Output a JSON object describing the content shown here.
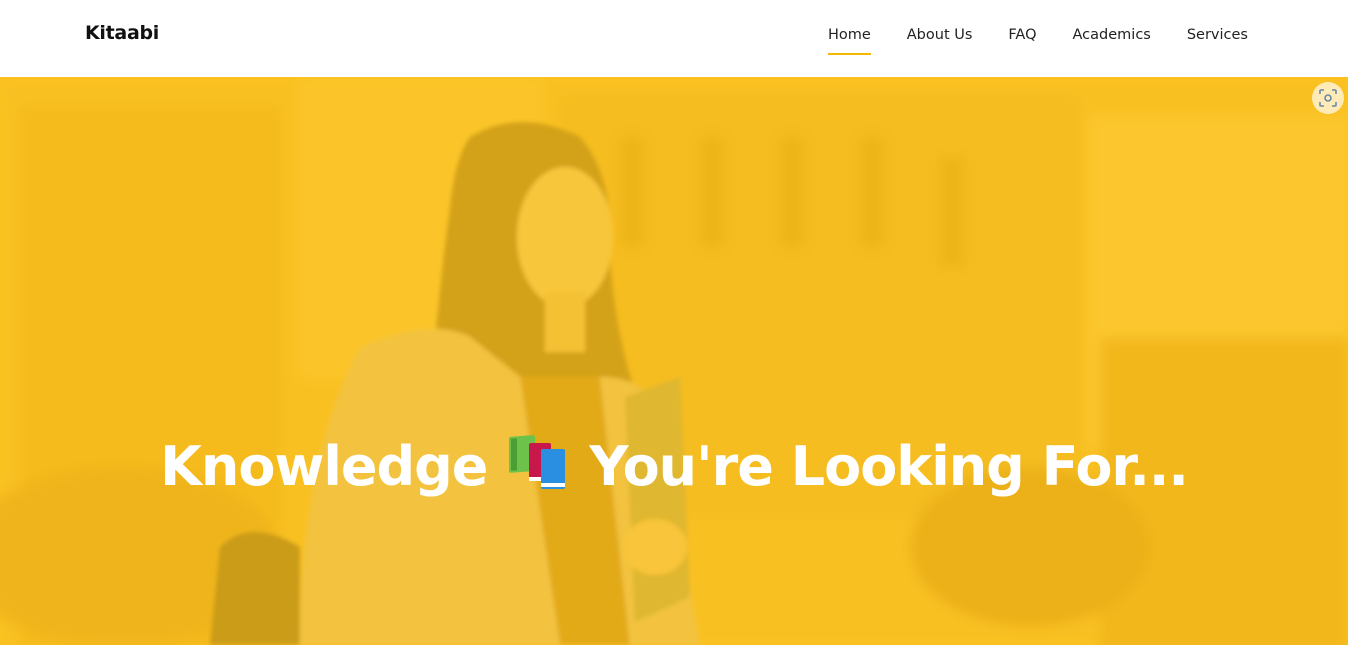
{
  "brand": {
    "name": "Kitaabi"
  },
  "nav": {
    "items": [
      {
        "label": "Home",
        "active": true
      },
      {
        "label": "About Us",
        "active": false
      },
      {
        "label": "FAQ",
        "active": false
      },
      {
        "label": "Academics",
        "active": false
      },
      {
        "label": "Services",
        "active": false
      }
    ]
  },
  "hero": {
    "title_before_icon": "Knowledge",
    "title_after_icon": "You're Looking For...",
    "icon": "books-icon",
    "overlay_color": "#F8C022"
  },
  "floating_button": {
    "icon": "screen-capture-icon"
  },
  "colors": {
    "accent": "#F5B800",
    "text": "#222222",
    "hero_text": "#FFFFFF"
  }
}
